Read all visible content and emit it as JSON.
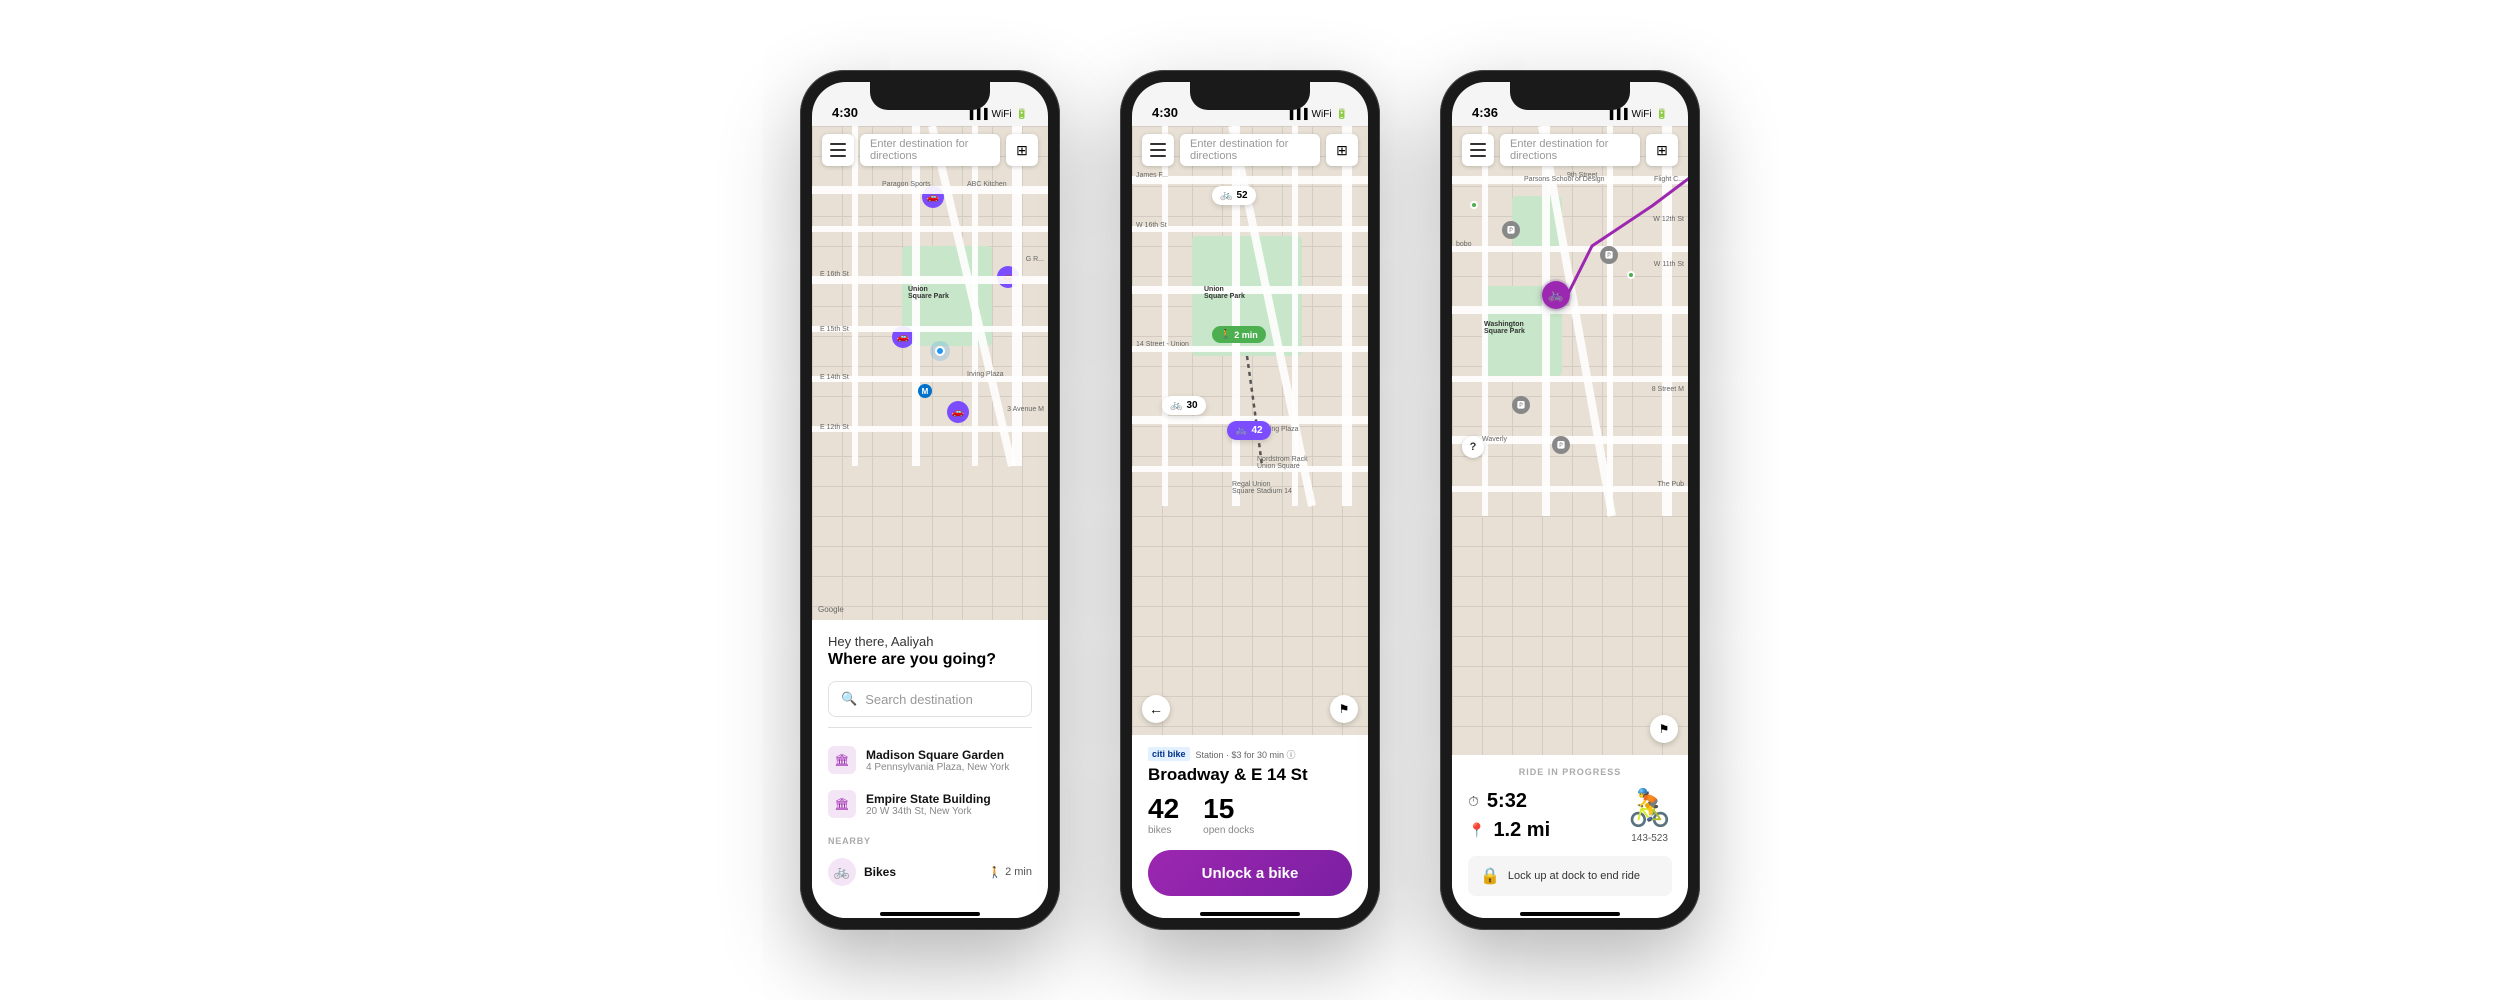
{
  "phones": [
    {
      "id": "phone1",
      "status": {
        "time": "4:30",
        "icons": "▐▐▐ ▲ ⊛"
      },
      "searchBar": {
        "placeholder": "Enter destination for directions"
      },
      "bottomPanel": {
        "greeting": "Hey there, Aaliyah",
        "question": "Where are you going?",
        "searchPlaceholder": "Search destination",
        "locations": [
          {
            "name": "Madison Square Garden",
            "address": "4 Pennsylvania Plaza, New York"
          },
          {
            "name": "Empire State Building",
            "address": "20 W 34th St, New York"
          }
        ],
        "nearbyLabel": "NEARBY",
        "nearbyItems": [
          {
            "name": "Bikes",
            "time": "2 min"
          }
        ]
      }
    },
    {
      "id": "phone2",
      "status": {
        "time": "4:30",
        "icons": "▐▐▐ ▲ ⊛"
      },
      "searchBar": {
        "placeholder": "Enter destination for directions"
      },
      "stationPanel": {
        "brand": "citi bike",
        "meta": "Station · $3 for 30 min ⓘ",
        "name": "Broadway & E 14 St",
        "bikes": {
          "count": "42",
          "label": "bikes"
        },
        "docks": {
          "count": "15",
          "label": "open docks"
        },
        "unlockBtn": "Unlock a bike"
      }
    },
    {
      "id": "phone3",
      "status": {
        "time": "4:36",
        "icons": "▐▐▐ ▲ ⊛"
      },
      "searchBar": {
        "placeholder": "Enter destination for directions"
      },
      "ridePanel": {
        "rideLabel": "RIDE IN PROGRESS",
        "time": "5:32",
        "distance": "1.2 mi",
        "bikeNumber": "143-523",
        "lockNotice": "Lock up at dock to end ride"
      }
    }
  ]
}
